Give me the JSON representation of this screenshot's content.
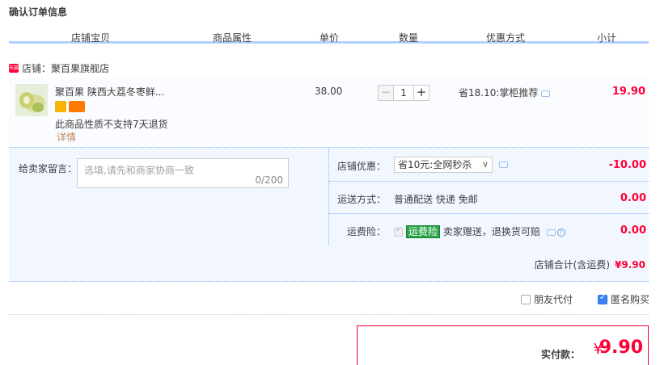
{
  "page": {
    "title": "确认订单信息"
  },
  "columns": [
    "店铺宝贝",
    "商品属性",
    "单价",
    "数量",
    "优惠方式",
    "小计"
  ],
  "shop": {
    "label": "店铺：聚百果旗舰店",
    "badge": "天猫"
  },
  "item": {
    "title": "聚百果 陕西大荔冬枣鲜...",
    "return_policy": "此商品性质不支持7天退货",
    "detail_link": "详情",
    "unit_price": "38.00",
    "quantity": "1",
    "minus": "−",
    "plus": "+",
    "promotion": "省18.10:掌柜推荐",
    "subtotal": "19.90"
  },
  "message": {
    "label": "给卖家留言：",
    "placeholder": "选填,请先和商家协商一致",
    "count": "0/200"
  },
  "discount": {
    "label": "店铺优惠：",
    "selected": "省10元:全网秒杀",
    "amount": "-10.00"
  },
  "shipping": {
    "label": "运送方式：",
    "value": "普通配送 快递 免邮",
    "amount": "0.00"
  },
  "insurance": {
    "label": "运费险：",
    "tag": "运费险",
    "note": "卖家赠送，退换货可赔",
    "amount": "0.00"
  },
  "shop_total": {
    "label": "店铺合计(含运费)",
    "amount": "¥9.90"
  },
  "options": {
    "friend_pay": {
      "label": "朋友代付",
      "checked": false
    },
    "anonymous": {
      "label": "匿名购买",
      "checked": true
    }
  },
  "payment": {
    "label": "实付款：",
    "currency": "¥",
    "amount": "9.90"
  },
  "colors": {
    "accent": "#ff0036",
    "header_rule": "#b2d1ff",
    "panel_bg": "#f2f7ff",
    "insurance_tag": "#2aa449"
  },
  "icons": [
    "shop-badge-icon",
    "chat-icon",
    "help-icon",
    "chevron-down-icon"
  ]
}
